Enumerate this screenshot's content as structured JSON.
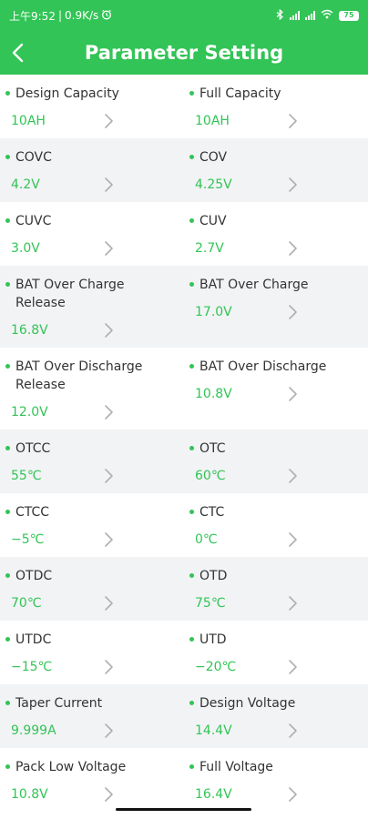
{
  "status_bar": {
    "time": "上午9:52",
    "separator": "|",
    "net_speed": "0.9K/s",
    "battery": "75"
  },
  "header": {
    "title": "Parameter Setting"
  },
  "colors": {
    "accent": "#32c456",
    "stripe": "#f2f3f5",
    "label": "#333333"
  },
  "rows": [
    {
      "left": {
        "label": "Design Capacity",
        "value": "10AH"
      },
      "right": {
        "label": "Full Capacity",
        "value": "10AH"
      }
    },
    {
      "left": {
        "label": "COVC",
        "value": "4.2V"
      },
      "right": {
        "label": "COV",
        "value": "4.25V"
      }
    },
    {
      "left": {
        "label": "CUVC",
        "value": "3.0V"
      },
      "right": {
        "label": "CUV",
        "value": "2.7V"
      }
    },
    {
      "left": {
        "label": "BAT Over Charge\nRelease",
        "value": "16.8V"
      },
      "right": {
        "label": "BAT Over Charge",
        "value": "17.0V"
      }
    },
    {
      "left": {
        "label": "BAT Over Discharge\nRelease",
        "value": "12.0V"
      },
      "right": {
        "label": "BAT Over Discharge",
        "value": "10.8V"
      }
    },
    {
      "left": {
        "label": "OTCC",
        "value": "55℃"
      },
      "right": {
        "label": "OTC",
        "value": "60℃"
      }
    },
    {
      "left": {
        "label": "CTCC",
        "value": "−5℃"
      },
      "right": {
        "label": "CTC",
        "value": "0℃"
      }
    },
    {
      "left": {
        "label": "OTDC",
        "value": "70℃"
      },
      "right": {
        "label": "OTD",
        "value": "75℃"
      }
    },
    {
      "left": {
        "label": "UTDC",
        "value": "−15℃"
      },
      "right": {
        "label": "UTD",
        "value": "−20℃"
      }
    },
    {
      "left": {
        "label": "Taper Current",
        "value": "9.999A"
      },
      "right": {
        "label": "Design Voltage",
        "value": "14.4V"
      }
    },
    {
      "left": {
        "label": "Pack Low Voltage",
        "value": "10.8V"
      },
      "right": {
        "label": "Full Voltage",
        "value": "16.4V"
      }
    }
  ]
}
